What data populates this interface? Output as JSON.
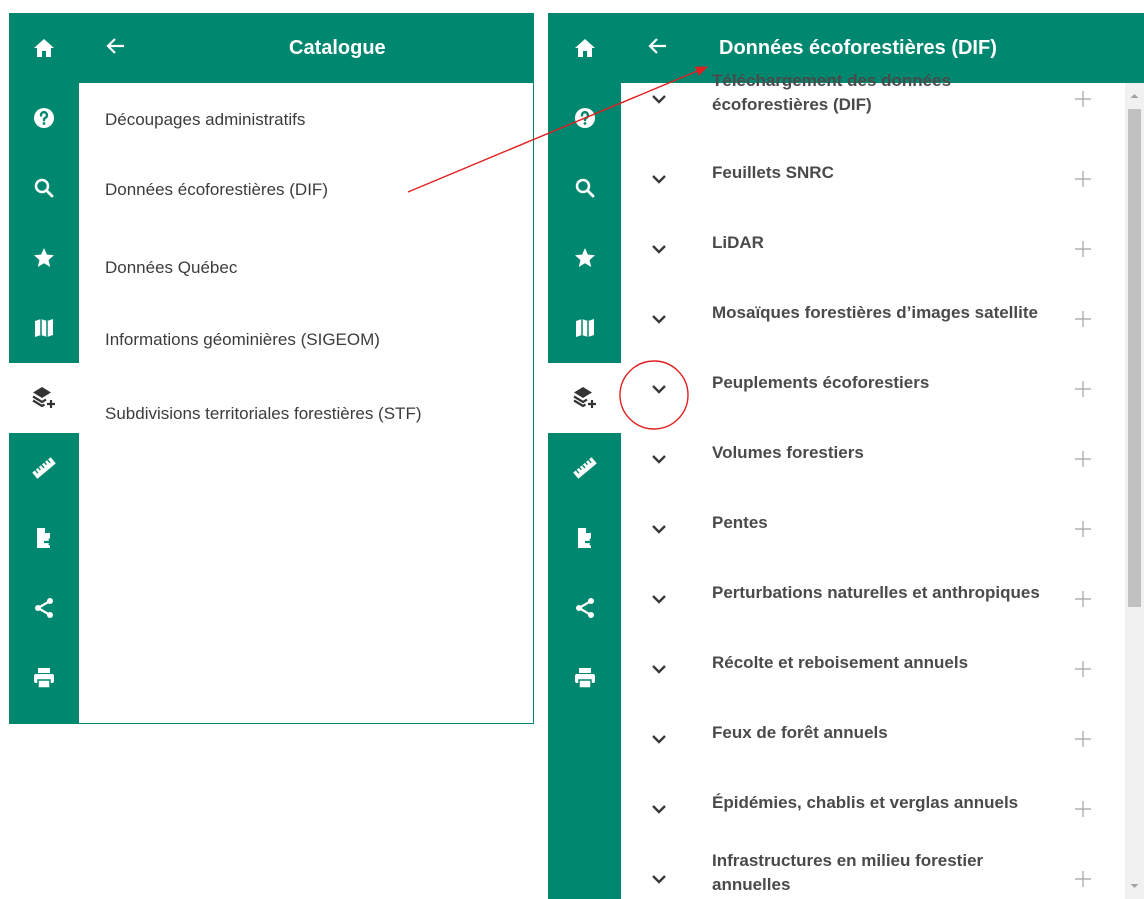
{
  "left": {
    "rail_icons": [
      "home-icon",
      "help-icon",
      "search-icon",
      "star-icon",
      "map-icon",
      "layers-add-icon",
      "ruler-icon",
      "file-export-icon",
      "share-icon",
      "print-icon"
    ],
    "active_icon": "layers-add-icon",
    "header": {
      "title": "Catalogue",
      "back_icon": "arrow-left-icon"
    },
    "items": [
      {
        "label": "Découpages administratifs"
      },
      {
        "label": "Données écoforestières (DIF)"
      },
      {
        "label": "Données Québec"
      },
      {
        "label": "Informations géominières (SIGEOM)"
      },
      {
        "label": "Subdivisions territoriales forestières (STF)"
      }
    ]
  },
  "right": {
    "rail_icons": [
      "home-icon",
      "help-icon",
      "search-icon",
      "star-icon",
      "map-icon",
      "layers-add-icon",
      "ruler-icon",
      "file-export-icon",
      "share-icon",
      "print-icon"
    ],
    "active_icon": "layers-add-icon",
    "header": {
      "title": "Données écoforestières (DIF)",
      "back_icon": "arrow-left-icon"
    },
    "items": [
      {
        "label": "Téléchargement des données écoforestières (DIF)"
      },
      {
        "label": "Feuillets SNRC"
      },
      {
        "label": "LiDAR"
      },
      {
        "label": "Mosaïques forestières d’images satellite"
      },
      {
        "label": "Peuplements écoforestiers"
      },
      {
        "label": "Volumes forestiers"
      },
      {
        "label": "Pentes"
      },
      {
        "label": "Perturbations naturelles et anthropiques"
      },
      {
        "label": "Récolte et reboisement annuels"
      },
      {
        "label": "Feux de forêt annuels"
      },
      {
        "label": "Épidémies, chablis et verglas annuels"
      },
      {
        "label": "Infrastructures en milieu forestier annuelles"
      }
    ]
  },
  "colors": {
    "brand_green": "#00876f",
    "annotation_red": "#e02020",
    "plus_gray": "#b0b0b0",
    "scrollbar": "#c1c1c1"
  }
}
